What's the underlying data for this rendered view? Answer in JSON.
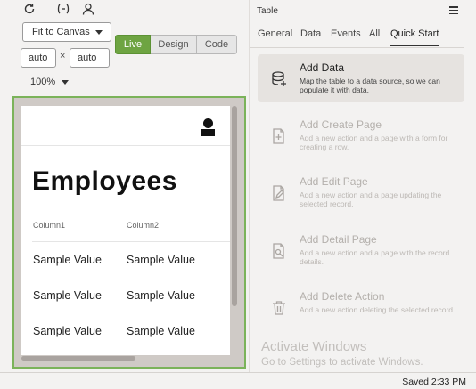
{
  "toolbar": {
    "icons": [
      "refresh-icon",
      "variables-icon",
      "user-icon"
    ],
    "fit_label": "Fit to Canvas",
    "width_value": "auto",
    "height_value": "auto",
    "times_symbol": "×",
    "zoom": "100%",
    "modes": {
      "live": "Live",
      "design": "Design",
      "code": "Code",
      "active": "Live"
    }
  },
  "colors": {
    "live_green": "#6ea442",
    "canvas_border": "#7bb35a"
  },
  "preview": {
    "title": "Employees",
    "columns": [
      "Column1",
      "Column2"
    ],
    "rows": [
      [
        "Sample Value",
        "Sample Value"
      ],
      [
        "Sample Value",
        "Sample Value"
      ],
      [
        "Sample Value",
        "Sample Value"
      ]
    ]
  },
  "panel": {
    "title": "Table",
    "tabs": [
      "General",
      "Data",
      "Events",
      "All",
      "Quick Start"
    ],
    "active_tab": "Quick Start",
    "quick_start": [
      {
        "title": "Add Data",
        "desc": "Map the table to a data source, so we can populate it with data.",
        "icon": "database-icon",
        "enabled": true
      },
      {
        "title": "Add Create Page",
        "desc": "Add a new action and a page with a form for creating a row.",
        "icon": "create-page-icon",
        "enabled": false
      },
      {
        "title": "Add Edit Page",
        "desc": "Add a new action and a page updating the selected record.",
        "icon": "edit-page-icon",
        "enabled": false
      },
      {
        "title": "Add Detail Page",
        "desc": "Add a new action and a page with the record details.",
        "icon": "detail-page-icon",
        "enabled": false
      },
      {
        "title": "Add Delete Action",
        "desc": "Add a new action deleting the selected record.",
        "icon": "trash-icon",
        "enabled": false
      }
    ]
  },
  "watermark": {
    "line1": "Activate Windows",
    "line2": "Go to Settings to activate Windows."
  },
  "status": {
    "text": "Saved 2:33 PM"
  }
}
